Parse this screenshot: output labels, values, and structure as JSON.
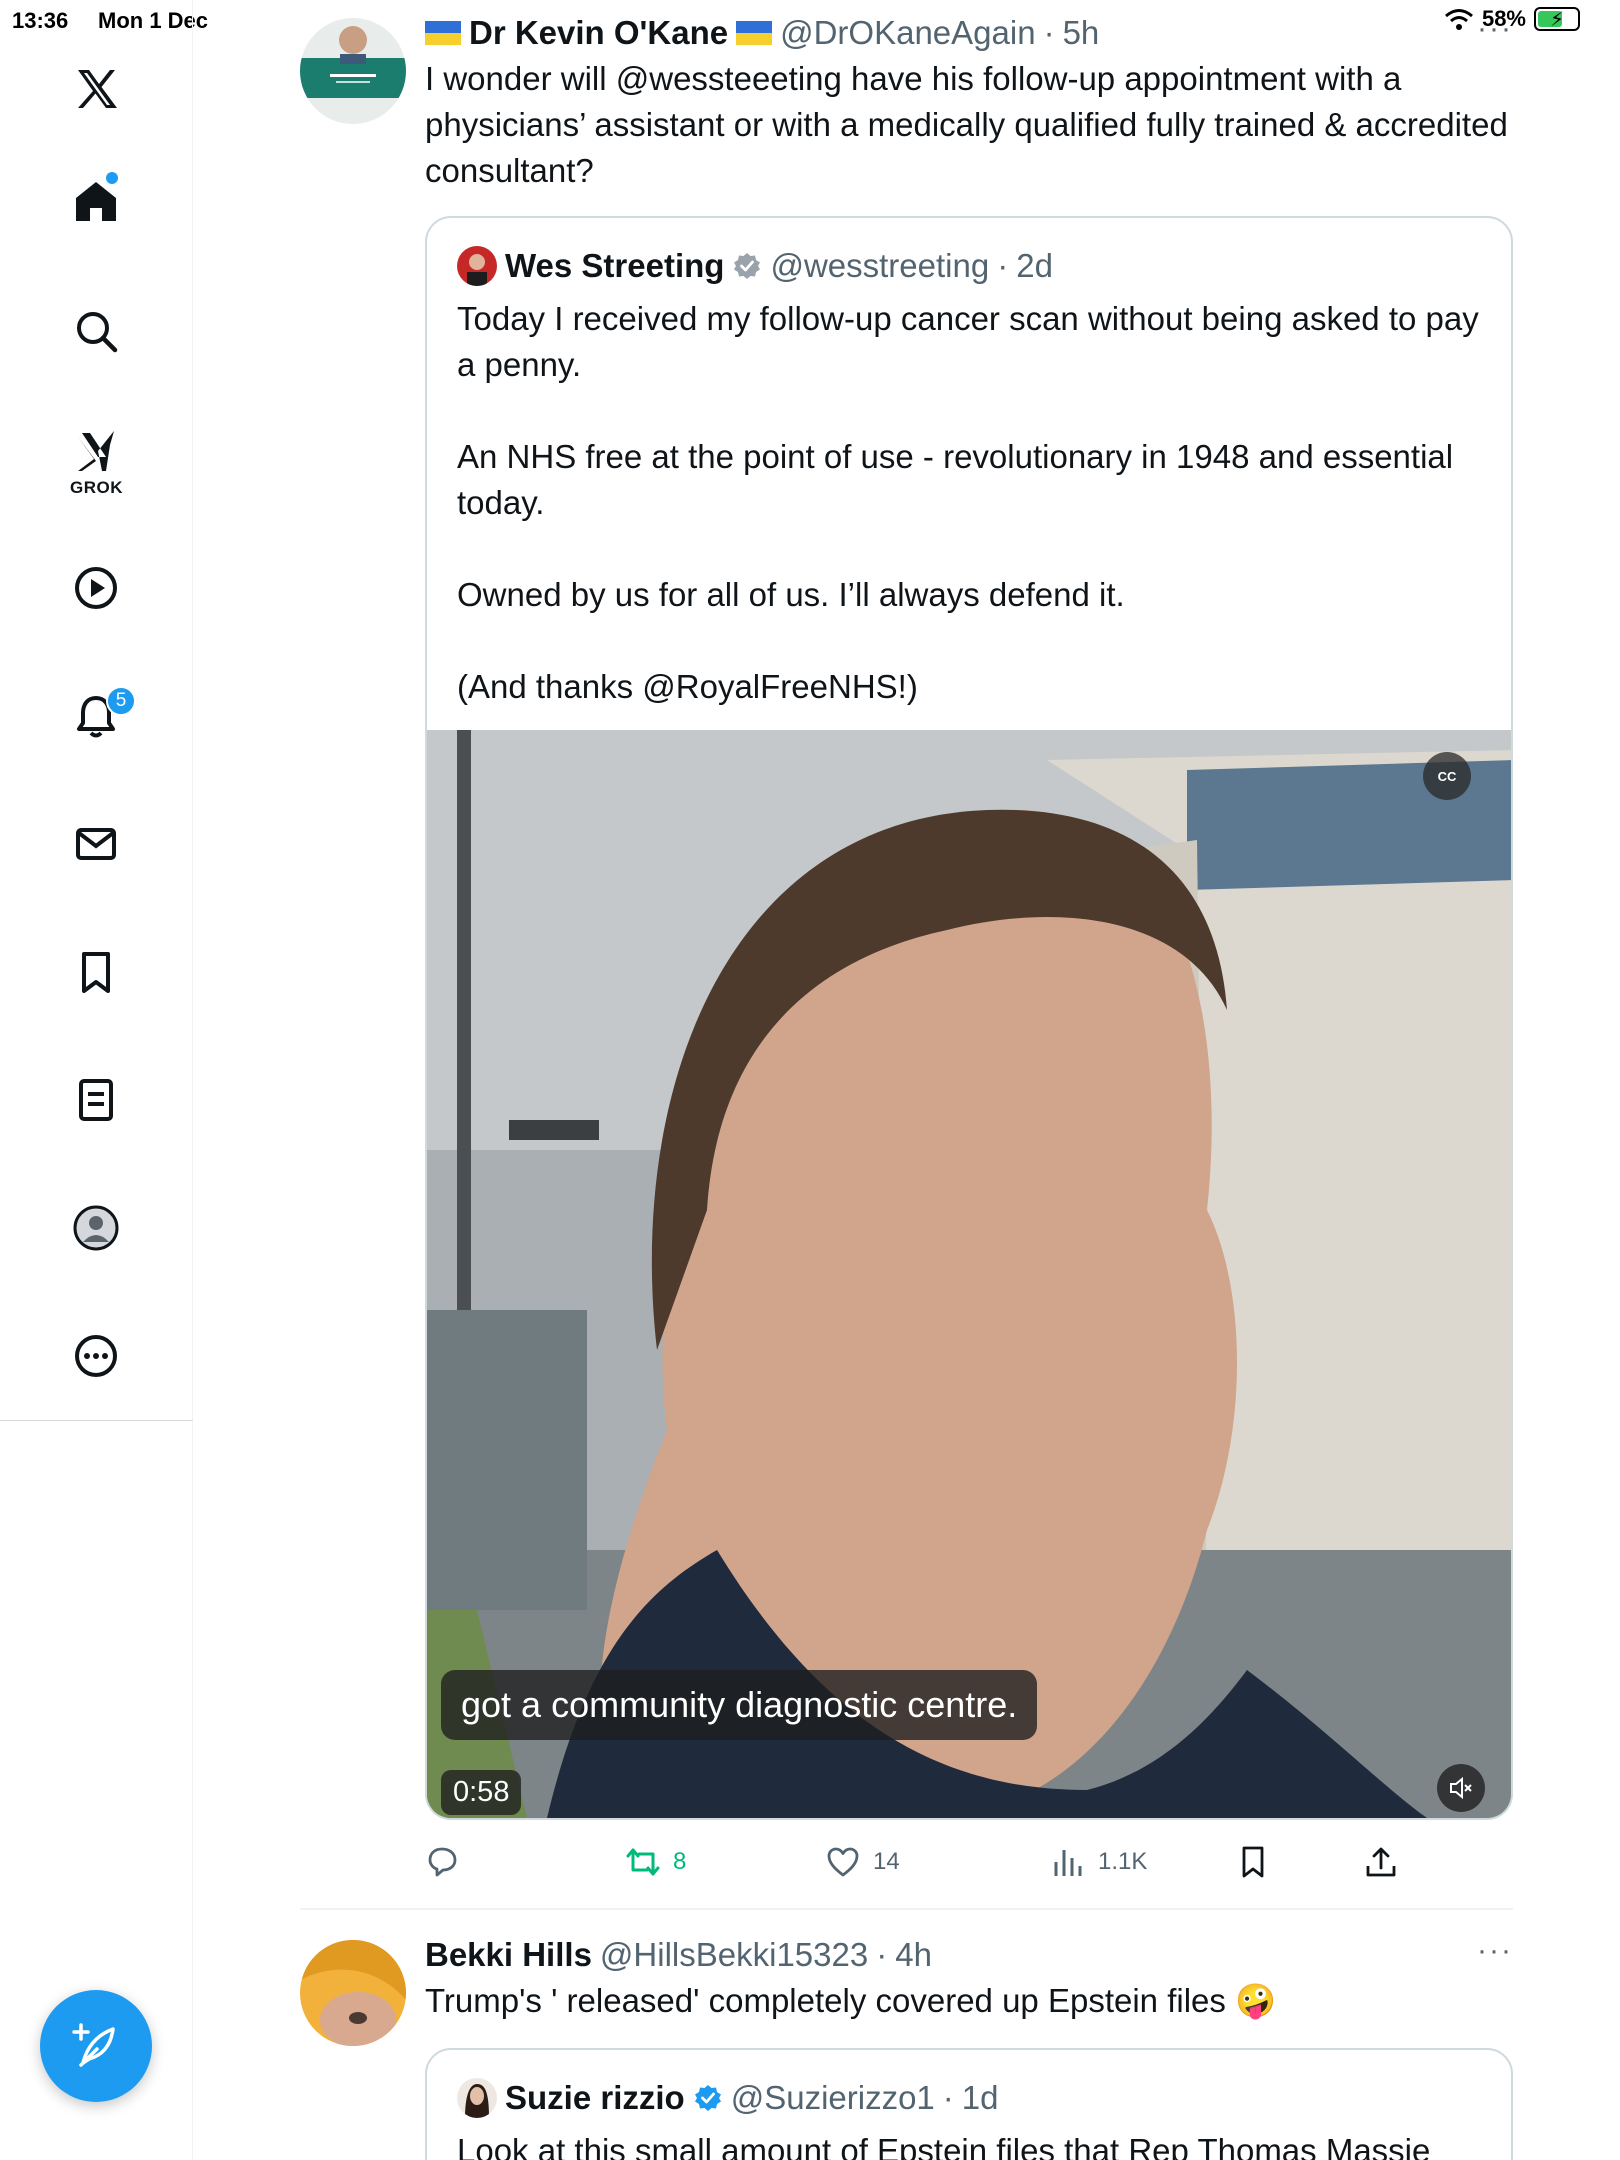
{
  "status_bar": {
    "time": "13:36",
    "date": "Mon 1 Dec",
    "battery": "58%"
  },
  "sidebar": {
    "items": [
      {
        "icon": "x-logo-icon"
      },
      {
        "icon": "home-icon"
      },
      {
        "icon": "search-icon"
      },
      {
        "icon": "grok-icon",
        "label": "GROK"
      },
      {
        "icon": "video-play-icon"
      },
      {
        "icon": "bell-icon",
        "badge": "5"
      },
      {
        "icon": "mail-icon"
      },
      {
        "icon": "bookmark-icon"
      },
      {
        "icon": "lists-icon"
      },
      {
        "icon": "profile-icon"
      },
      {
        "icon": "more-circle-icon"
      }
    ],
    "compose_icon": "compose-feather-icon"
  },
  "tweets": [
    {
      "author": "Dr Kevin O'Kane",
      "handle": "@DrOKaneAgain",
      "time": "5h",
      "text": "I wonder will @wessteeeting have his follow-up appointment with a physicians’ assistant or with a medically qualified fully trained & accredited consultant?",
      "quote": {
        "author": "Wes Streeting",
        "handle": "@wesstreeting",
        "time": "2d",
        "paragraphs": [
          "Today I received my follow-up cancer scan without being asked to pay a penny.",
          "An NHS free at the point of use - revolutionary in 1948 and essential today.",
          "Owned by us for all of us. I’ll always defend it.",
          "(And thanks @RoyalFreeNHS!)"
        ],
        "video": {
          "caption": "got a community diagnostic centre.",
          "duration": "0:58",
          "cc_label": "CC"
        }
      },
      "actions": {
        "replies": "",
        "reposts": "8",
        "likes": "14",
        "views": "1.1K"
      }
    },
    {
      "author": "Bekki Hills",
      "handle": "@HillsBekki15323",
      "time": "4h",
      "text": "Trump's ' released' completely covered up Epstein files",
      "emoji": "🤪",
      "quote": {
        "author": "Suzie rizzio",
        "handle": "@Suzierizzo1",
        "time": "1d",
        "text": "Look at this small amount of Epstein files that Rep Thomas Massie"
      }
    }
  ],
  "colors": {
    "accent": "#1d9bf0",
    "text": "#0f1419",
    "muted": "#536471",
    "repost": "#00ba7c",
    "border": "#cfd9de"
  }
}
